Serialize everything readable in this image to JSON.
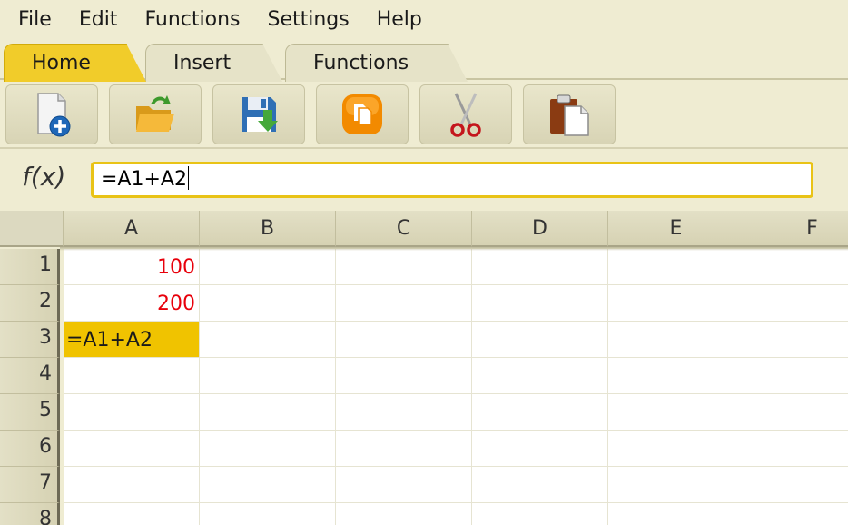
{
  "menu": [
    "File",
    "Edit",
    "Functions",
    "Settings",
    "Help"
  ],
  "tabs": [
    {
      "label": "Home",
      "active": true
    },
    {
      "label": "Insert",
      "active": false
    },
    {
      "label": "Functions",
      "active": false
    }
  ],
  "toolbar": {
    "buttons": [
      {
        "icon": "new-document-icon"
      },
      {
        "icon": "open-folder-icon"
      },
      {
        "icon": "save-icon"
      },
      {
        "icon": "copy-icon"
      },
      {
        "icon": "scissors-icon"
      },
      {
        "icon": "paste-icon"
      }
    ]
  },
  "formula": {
    "label": "f(x)",
    "value": "=A1+A2"
  },
  "sheet": {
    "columns": [
      "A",
      "B",
      "C",
      "D",
      "E",
      "F"
    ],
    "rows": [
      "1",
      "2",
      "3",
      "4",
      "5",
      "6",
      "7",
      "8"
    ],
    "cells": {
      "A1": "100",
      "A2": "200",
      "A3": "=A1+A2"
    },
    "selected": "A3"
  },
  "colors": {
    "accent": "#f0c300",
    "background": "#efecd2",
    "number_text": "#e8000b"
  }
}
